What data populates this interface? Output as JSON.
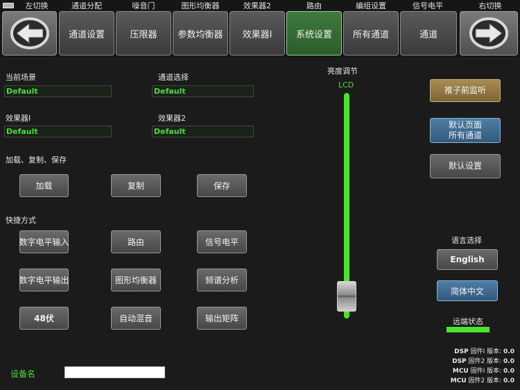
{
  "topnav": {
    "labels": [
      "左切换",
      "通道分配",
      "噪音门",
      "图形均衡器",
      "效果器2",
      "路由",
      "编组设置",
      "信号电平",
      "右切换"
    ],
    "buttons": [
      "通道设置",
      "压限器",
      "参数均衡器",
      "效果器I",
      "系统设置",
      "所有通道",
      "通道"
    ],
    "active_index": 4
  },
  "scene": {
    "current_label": "当前场景",
    "current_value": "Default",
    "channel_label": "通道选择",
    "channel_value": "Default",
    "fx1_label": "效果器I",
    "fx1_value": "Default",
    "fx2_label": "效果器2",
    "fx2_value": "Default"
  },
  "file_ops": {
    "title": "加载、复制、保存",
    "load": "加载",
    "copy": "复制",
    "save": "保存"
  },
  "shortcuts": {
    "title": "快捷方式",
    "items": [
      "数字电平输入",
      "路由",
      "信号电平",
      "数字电平输出",
      "图形均衡器",
      "频谱分析",
      "48伏",
      "自动混音",
      "输出矩阵"
    ]
  },
  "device": {
    "label": "设备名",
    "value": ""
  },
  "brightness": {
    "title": "亮度调节",
    "lcd_label": "LCD",
    "level_fraction": 0.1,
    "track_color": "#49e52c"
  },
  "right_panel": {
    "pre_fader": "推子前监听",
    "default_page_line1": "默认页面",
    "default_page_line2": "所有通道",
    "default_settings": "默认设置",
    "language_title": "语言选择",
    "english": "English",
    "chinese": "简体中文",
    "remote_status": "远端状态",
    "remote_status_color": "#49e52c"
  },
  "firmware": [
    {
      "prefix": "DSP",
      "text": "固件I 版本:",
      "version": "0.0"
    },
    {
      "prefix": "DSP",
      "text": "固件2 版本:",
      "version": "0.0"
    },
    {
      "prefix": "MCU",
      "text": "固件I 版本:",
      "version": "0.0"
    },
    {
      "prefix": "MCU",
      "text": "固件2 版本:",
      "version": "0.0"
    }
  ],
  "colors": {
    "active_tab": "#3e7a3e",
    "field_text": "#4ddc3c",
    "accent_gold": "#a88c52",
    "accent_blue": "#4d7ea6"
  }
}
